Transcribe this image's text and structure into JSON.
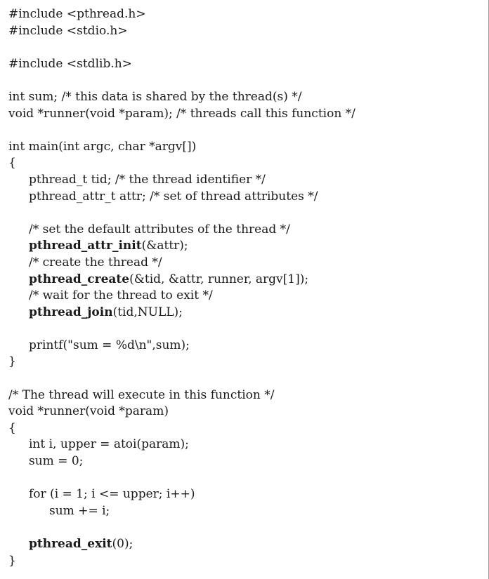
{
  "lines": [
    {
      "indent": 0,
      "parts": [
        {
          "t": "#include <pthread.h>"
        }
      ]
    },
    {
      "indent": 0,
      "parts": [
        {
          "t": "#include <stdio.h>"
        }
      ]
    },
    {
      "indent": 0,
      "parts": []
    },
    {
      "indent": 0,
      "parts": [
        {
          "t": "#include <stdlib.h>"
        }
      ]
    },
    {
      "indent": 0,
      "parts": []
    },
    {
      "indent": 0,
      "parts": [
        {
          "t": "int sum; /* this data is shared by the thread(s) */"
        }
      ]
    },
    {
      "indent": 0,
      "parts": [
        {
          "t": "void *runner(void *param); /* threads call this function */"
        }
      ]
    },
    {
      "indent": 0,
      "parts": []
    },
    {
      "indent": 0,
      "parts": [
        {
          "t": "int main(int argc, char *argv[])"
        }
      ]
    },
    {
      "indent": 0,
      "parts": [
        {
          "t": "{"
        }
      ]
    },
    {
      "indent": 1,
      "parts": [
        {
          "t": "pthread_t tid; /* the thread identifier */"
        }
      ]
    },
    {
      "indent": 1,
      "parts": [
        {
          "t": "pthread_attr_t attr; /* set of thread attributes */"
        }
      ]
    },
    {
      "indent": 0,
      "parts": []
    },
    {
      "indent": 1,
      "parts": [
        {
          "t": "/* set the default attributes of the thread */"
        }
      ]
    },
    {
      "indent": 1,
      "parts": [
        {
          "t": "pthread_attr_init",
          "b": true
        },
        {
          "t": "(&attr);"
        }
      ]
    },
    {
      "indent": 1,
      "parts": [
        {
          "t": "/* create the thread */"
        }
      ]
    },
    {
      "indent": 1,
      "parts": [
        {
          "t": "pthread_create",
          "b": true
        },
        {
          "t": "(&tid, &attr, runner, argv[1]);"
        }
      ]
    },
    {
      "indent": 1,
      "parts": [
        {
          "t": "/* wait for the thread to exit */"
        }
      ]
    },
    {
      "indent": 1,
      "parts": [
        {
          "t": "pthread_join",
          "b": true
        },
        {
          "t": "(tid,NULL);"
        }
      ]
    },
    {
      "indent": 0,
      "parts": []
    },
    {
      "indent": 1,
      "parts": [
        {
          "t": "printf(\"sum = %d\\n\",sum);"
        }
      ]
    },
    {
      "indent": 0,
      "parts": [
        {
          "t": "}"
        }
      ]
    },
    {
      "indent": 0,
      "parts": []
    },
    {
      "indent": 0,
      "parts": [
        {
          "t": "/* The thread will execute in this function */"
        }
      ]
    },
    {
      "indent": 0,
      "parts": [
        {
          "t": "void *runner(void *param)"
        }
      ]
    },
    {
      "indent": 0,
      "parts": [
        {
          "t": "{"
        }
      ]
    },
    {
      "indent": 1,
      "parts": [
        {
          "t": "int i, upper = atoi(param);"
        }
      ]
    },
    {
      "indent": 1,
      "parts": [
        {
          "t": "sum = 0;"
        }
      ]
    },
    {
      "indent": 0,
      "parts": []
    },
    {
      "indent": 1,
      "parts": [
        {
          "t": "for (i = 1; i <= upper; i++)"
        }
      ]
    },
    {
      "indent": 2,
      "parts": [
        {
          "t": "sum += i;"
        }
      ]
    },
    {
      "indent": 0,
      "parts": []
    },
    {
      "indent": 1,
      "parts": [
        {
          "t": "pthread_exit",
          "b": true
        },
        {
          "t": "(0);"
        }
      ]
    },
    {
      "indent": 0,
      "parts": [
        {
          "t": "}"
        }
      ]
    }
  ]
}
